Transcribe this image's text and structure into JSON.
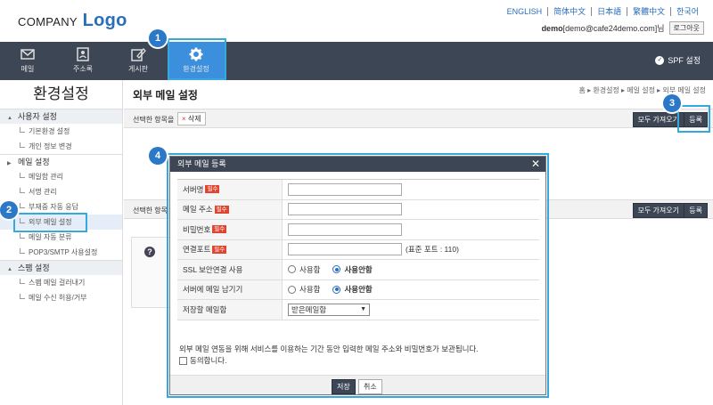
{
  "header": {
    "logo_company": "COMPANY",
    "logo_word": "Logo",
    "languages": [
      "ENGLISH",
      "简体中文",
      "日本語",
      "繁體中文",
      "한국어"
    ],
    "user_id": "demo",
    "user_email": "[demo@cafe24demo.com]님",
    "logout": "로그아웃"
  },
  "nav": {
    "items": [
      {
        "label": "메일",
        "icon": "mail-icon"
      },
      {
        "label": "주소록",
        "icon": "address-book-icon"
      },
      {
        "label": "게시판",
        "icon": "edit-icon"
      },
      {
        "label": "환경설정",
        "icon": "gear-icon"
      }
    ],
    "spf": "SPF 설정"
  },
  "callouts": [
    "1",
    "2",
    "3",
    "4"
  ],
  "sidebar": {
    "title": "환경설정",
    "groups": [
      {
        "label": "사용자 설정",
        "items": [
          "기본환경 설정",
          "개인 정보 변경"
        ]
      },
      {
        "label": "메일 설정",
        "items": [
          "메일함 관리",
          "서명 관리",
          "부재중 자동 응답",
          "외부 메일 설정",
          "메일 자동 분류",
          "POP3/SMTP 사용설정"
        ]
      },
      {
        "label": "스팸 설정",
        "items": [
          "스팸 메일 걸러내기",
          "메일 수신 허용/거부"
        ]
      }
    ]
  },
  "main": {
    "title": "외부 메일 설정",
    "breadcrumb": "홈 ▸ 환경설정 ▸ 메일 설정 ▸ 외부 메일 설정",
    "selected_label": "선택한 항목을",
    "selected_label_short": "선택한 항목",
    "delete": "삭제",
    "fetch_all": "모두 가져오기",
    "register": "등록",
    "help_icon": "?"
  },
  "dialog": {
    "title": "외부 메일 등록",
    "close": "✕",
    "required": "필수",
    "fields": [
      {
        "label": "서버명",
        "required": true,
        "value": ""
      },
      {
        "label": "메일 주소",
        "required": true,
        "value": ""
      },
      {
        "label": "비밀번호",
        "required": true,
        "value": ""
      },
      {
        "label": "연결포트",
        "required": true,
        "value": "",
        "hint": "(표준 포트 : 110)"
      }
    ],
    "ssl": {
      "label": "SSL 보안연결 사용",
      "opt_use": "사용함",
      "opt_nouse": "사용안함",
      "selected": "사용안함"
    },
    "keep": {
      "label": "서버에 메일 남기기",
      "opt_use": "사용함",
      "opt_nouse": "사용안함",
      "selected": "사용안함"
    },
    "folder": {
      "label": "저장할 메일함",
      "selected": "받은메일함"
    },
    "note": "외부 메일 연동을 위해 서비스를 이용하는 기간 동안 입력한 메일 주소와 비밀번호가 보관됩니다.",
    "agree": "동의합니다.",
    "save": "저장",
    "cancel": "취소"
  },
  "colors": {
    "nav_bg": "#3d4654",
    "nav_active": "#3b8fdc",
    "highlight": "#35a8e0",
    "callout": "#2a78c7",
    "required": "#e0452f"
  }
}
